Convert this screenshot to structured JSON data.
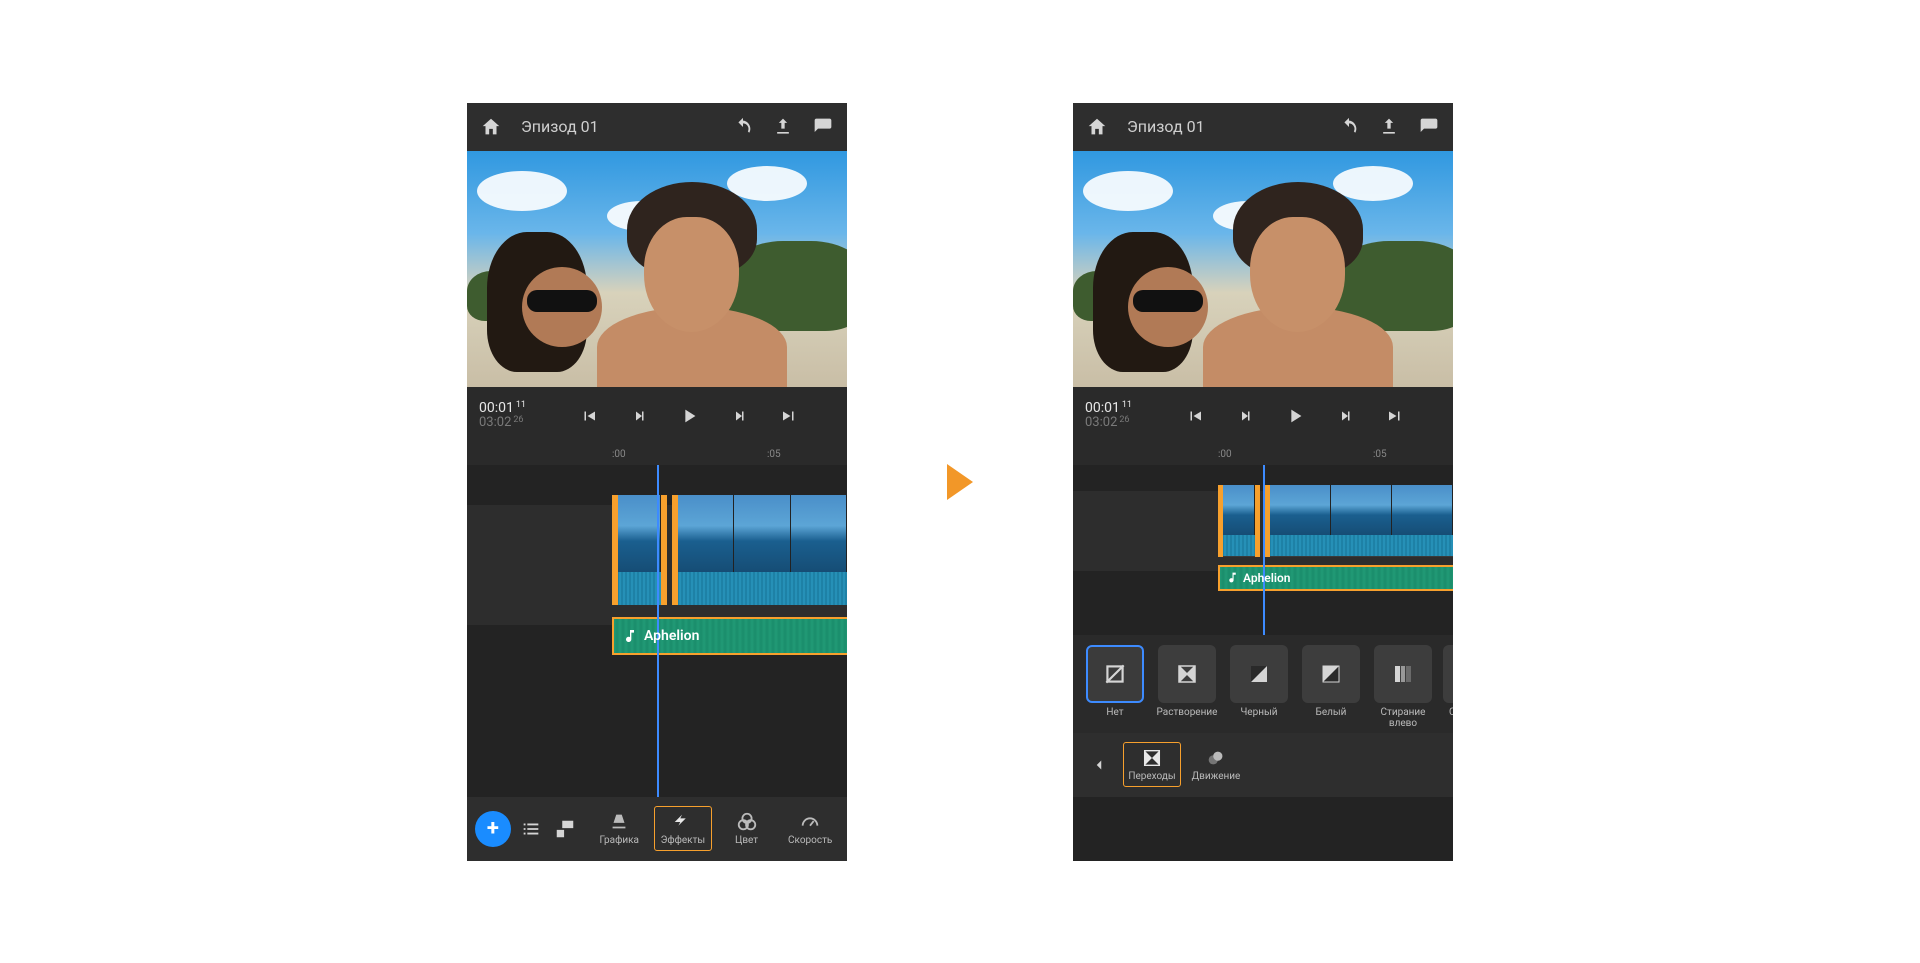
{
  "header": {
    "title": "Эпизод 01"
  },
  "preview": {
    "current_time": "00:01",
    "current_frames": "11",
    "total_time": "03:02",
    "total_frames": "26"
  },
  "ruler": {
    "mark1": ":00",
    "mark2": ":05"
  },
  "audio_clip": {
    "name": "Aphelion"
  },
  "bottom_left": {
    "graphics": "Графика",
    "effects": "Эффекты",
    "color": "Цвет",
    "speed": "Скорость"
  },
  "transitions": {
    "none": "Нет",
    "dissolve": "Растворение",
    "black": "Черный",
    "white": "Белый",
    "wipe_left": "Стирание влево",
    "wipe_right_partial": "Ст…"
  },
  "bottom_right": {
    "transitions": "Переходы",
    "motion": "Движение"
  }
}
